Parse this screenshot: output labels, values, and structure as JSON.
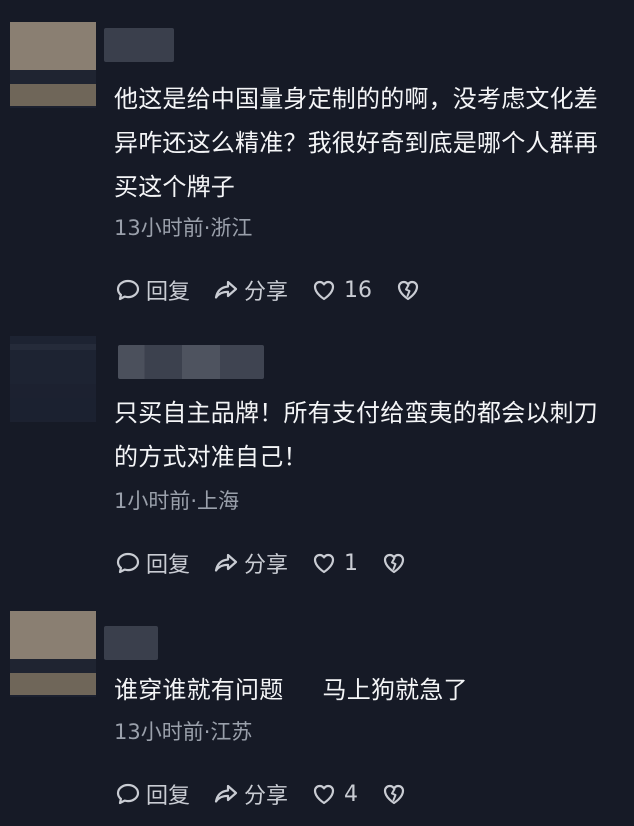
{
  "comments": [
    {
      "text": "他这是给中国量身定制的的啊，没考虑文化差异咋还这么精准？我很好奇到底是哪个人群再买这个牌子",
      "meta": "13小时前·浙江",
      "reply_label": "回复",
      "share_label": "分享",
      "like_count": "16"
    },
    {
      "text": "只买自主品牌！所有支付给蛮夷的都会以刺刀的方式对准自己！",
      "meta": "1小时前·上海",
      "reply_label": "回复",
      "share_label": "分享",
      "like_count": "1"
    },
    {
      "text": "谁穿谁就有问题     马上狗就急了",
      "meta": "13小时前·江苏",
      "reply_label": "回复",
      "share_label": "分享",
      "like_count": "4"
    }
  ],
  "icons": {
    "reply": "comment-bubble-icon",
    "share": "share-arrow-icon",
    "like": "heart-icon",
    "dislike": "broken-heart-icon"
  },
  "colors": {
    "background": "#161a26",
    "text": "#f4f5f7",
    "meta": "#9aa0ab",
    "actions": "#c9ccd3"
  }
}
